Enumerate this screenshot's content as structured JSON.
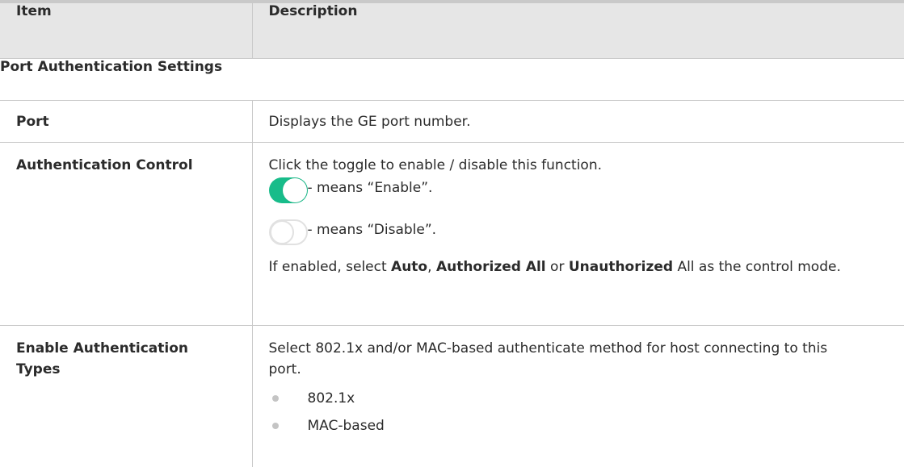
{
  "table": {
    "headers": [
      "Item",
      "Description"
    ],
    "section_title": "Port Authentication Settings",
    "rows": [
      {
        "item": "Port",
        "description": "Displays the GE port number."
      },
      {
        "item": "Authentication Control",
        "intro": "Click the toggle to enable / disable this function.",
        "toggle_on_text": "- means “Enable”.",
        "toggle_off_text": "- means “Disable”.",
        "note_prefix": "If enabled, select ",
        "note_auto": "Auto",
        "note_sep1": ", ",
        "note_authorized_all": "Authorized All",
        "note_sep2": " or ",
        "note_unauthorized": "Unauthorized",
        "note_suffix": " All as the control mode."
      },
      {
        "item": "Enable Authentication Types",
        "intro": "Select 802.1x and/or MAC-based authenticate method for host connecting to this port.",
        "bullets": [
          "802.1x",
          "MAC-based"
        ]
      }
    ]
  },
  "colors": {
    "header_bg": "#e6e6e6",
    "rule": "#c9c9c9",
    "toggle_on": "#18bc8a"
  }
}
